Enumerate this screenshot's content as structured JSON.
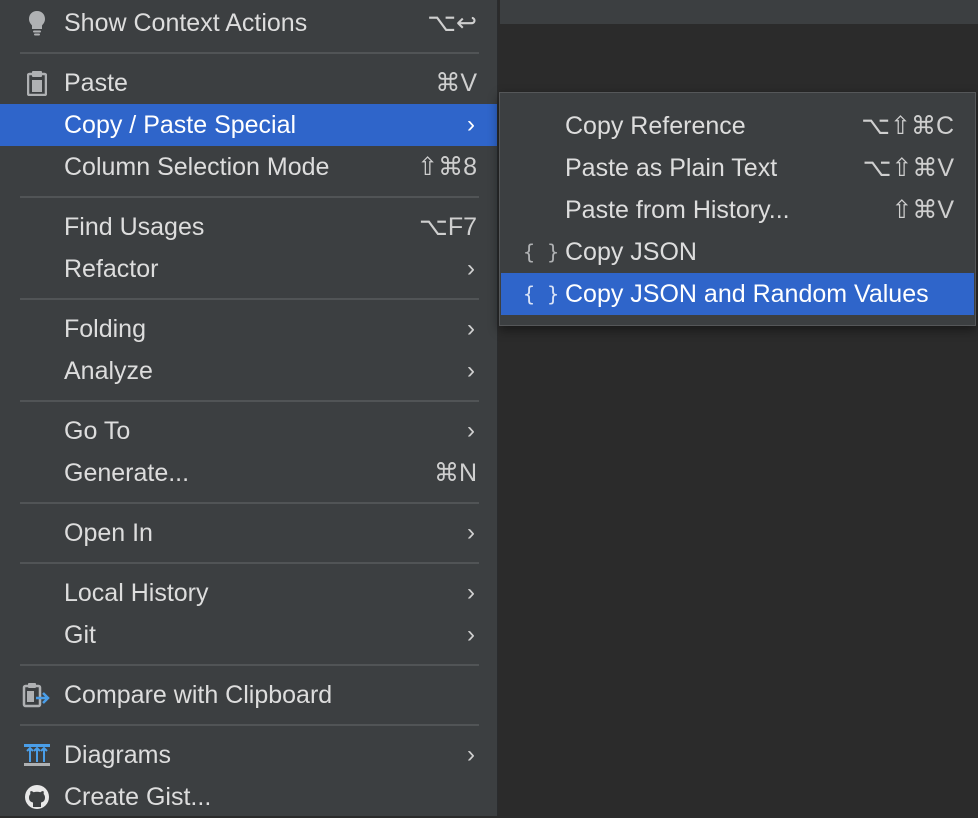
{
  "context_menu": {
    "items": [
      {
        "label": "Show Context Actions",
        "shortcut": "⌥↩",
        "icon": "lightbulb-icon"
      },
      {
        "label": "Paste",
        "shortcut": "⌘V",
        "icon": "clipboard-icon"
      },
      {
        "label": "Copy / Paste Special",
        "shortcut": ""
      },
      {
        "label": "Column Selection Mode",
        "shortcut": "⇧⌘8"
      },
      {
        "label": "Find Usages",
        "shortcut": "⌥F7"
      },
      {
        "label": "Refactor",
        "shortcut": ""
      },
      {
        "label": "Folding",
        "shortcut": ""
      },
      {
        "label": "Analyze",
        "shortcut": ""
      },
      {
        "label": "Go To",
        "shortcut": ""
      },
      {
        "label": "Generate...",
        "shortcut": "⌘N"
      },
      {
        "label": "Open In",
        "shortcut": ""
      },
      {
        "label": "Local History",
        "shortcut": ""
      },
      {
        "label": "Git",
        "shortcut": ""
      },
      {
        "label": "Compare with Clipboard",
        "shortcut": "",
        "icon": "compare-clipboard-icon"
      },
      {
        "label": "Diagrams",
        "shortcut": "",
        "icon": "diagrams-icon"
      },
      {
        "label": "Create Gist...",
        "shortcut": "",
        "icon": "github-icon"
      }
    ],
    "submenu_arrow": "›"
  },
  "submenu": {
    "parent": "Copy / Paste Special",
    "items": [
      {
        "label": "Copy Reference",
        "shortcut": "⌥⇧⌘C"
      },
      {
        "label": "Paste as Plain Text",
        "shortcut": "⌥⇧⌘V"
      },
      {
        "label": "Paste from History...",
        "shortcut": "⇧⌘V"
      },
      {
        "label": "Copy JSON",
        "shortcut": "",
        "icon_glyph": "{ }"
      },
      {
        "label": "Copy JSON and Random Values",
        "shortcut": "",
        "icon_glyph": "{ }"
      }
    ]
  },
  "colors": {
    "menu_bg": "#3c3f41",
    "selection": "#2f65ca",
    "text": "#dddddd",
    "separator": "#515456",
    "editor_bg": "#2b2b2b"
  }
}
